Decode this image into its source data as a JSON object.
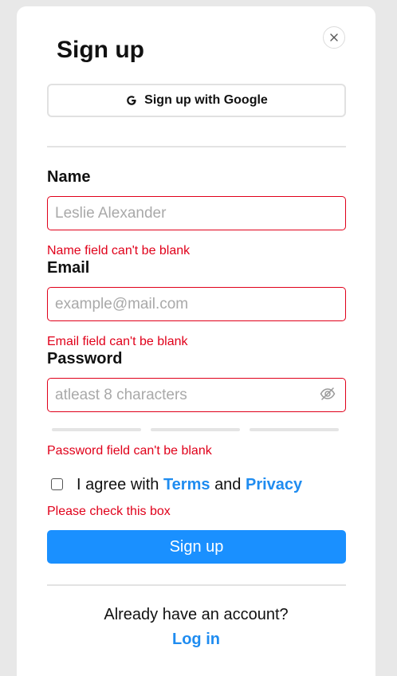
{
  "title": "Sign up",
  "google_button": "Sign up with Google",
  "fields": {
    "name": {
      "label": "Name",
      "value": "",
      "placeholder": "Leslie Alexander",
      "error": "Name field can't be blank"
    },
    "email": {
      "label": "Email",
      "value": "",
      "placeholder": "example@mail.com",
      "error": "Email field can't be blank"
    },
    "password": {
      "label": "Password",
      "value": "",
      "placeholder": "atleast 8 characters",
      "error": "Password field can't be blank"
    }
  },
  "agreement": {
    "prefix": "I agree with",
    "terms": "Terms",
    "and": "and",
    "privacy": "Privacy",
    "checked": false,
    "error": "Please check this box"
  },
  "submit_label": "Sign up",
  "footer": {
    "question": "Already have an account?",
    "login_label": "Log in"
  },
  "colors": {
    "accent": "#1a90ff",
    "link": "#1f8cf0",
    "error": "#e0001a",
    "background": "#e8e8e8"
  },
  "icons": {
    "close": "close-icon",
    "google": "google-icon",
    "password_visibility": "eye-off-icon"
  }
}
